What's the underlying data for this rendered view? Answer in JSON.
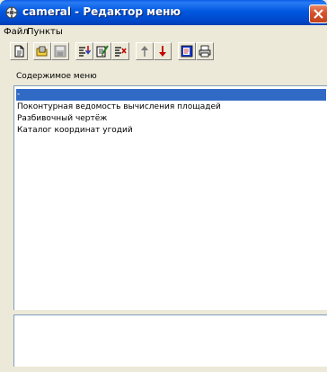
{
  "window": {
    "title": "cameral - Редактор меню",
    "icon": "app-icon",
    "close_icon": "close-icon"
  },
  "menubar": {
    "items": [
      {
        "label": "Файл"
      },
      {
        "label": "Пункты"
      }
    ]
  },
  "toolbar": {
    "buttons": [
      {
        "icon": "new-file-icon"
      },
      {
        "icon": "open-file-icon"
      },
      {
        "icon": "save-icon"
      },
      {
        "icon": "insert-item-icon"
      },
      {
        "icon": "edit-item-icon"
      },
      {
        "icon": "delete-item-icon"
      },
      {
        "icon": "move-up-icon"
      },
      {
        "icon": "move-down-icon"
      },
      {
        "icon": "preview-icon"
      },
      {
        "icon": "print-icon"
      }
    ]
  },
  "content": {
    "section_label": "Содержимое меню",
    "items": [
      {
        "label": "-",
        "selected": true
      },
      {
        "label": "Поконтурная ведомость вычисления площадей",
        "selected": false
      },
      {
        "label": "Разбивочный чертёж",
        "selected": false
      },
      {
        "label": "Каталог координат угодий",
        "selected": false
      }
    ]
  },
  "colors": {
    "title_bar": "#0054e3",
    "selection": "#316ac5",
    "window_bg": "#ece9d8",
    "close_button": "#d9542e"
  }
}
